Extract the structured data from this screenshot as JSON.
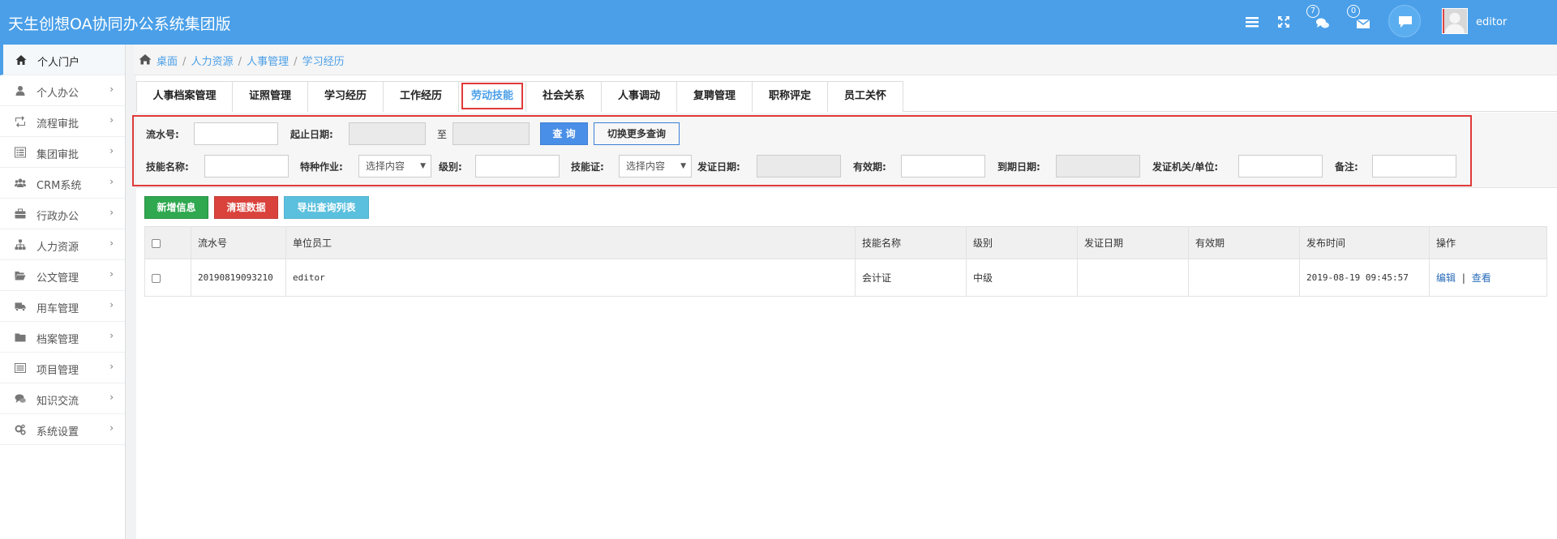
{
  "app": {
    "title": "天生创想OA协同办公系统集团版"
  },
  "header": {
    "icons": [
      "menu-icon",
      "fullscreen-icon",
      "chat-icon",
      "mail-icon",
      "comment-icon"
    ],
    "chat_badge": "7",
    "mail_badge": "0",
    "username": "editor"
  },
  "sidebar": {
    "items": [
      {
        "label": "个人门户",
        "icon": "home-icon"
      },
      {
        "label": "个人办公",
        "icon": "user-icon"
      },
      {
        "label": "流程审批",
        "icon": "retweet-icon"
      },
      {
        "label": "集团审批",
        "icon": "list-alt-icon"
      },
      {
        "label": "CRM系统",
        "icon": "users-icon"
      },
      {
        "label": "行政办公",
        "icon": "briefcase-icon"
      },
      {
        "label": "人力资源",
        "icon": "sitemap-icon"
      },
      {
        "label": "公文管理",
        "icon": "folder-open-icon"
      },
      {
        "label": "用车管理",
        "icon": "truck-icon"
      },
      {
        "label": "档案管理",
        "icon": "folder-icon"
      },
      {
        "label": "项目管理",
        "icon": "list-icon"
      },
      {
        "label": "知识交流",
        "icon": "comments-icon"
      },
      {
        "label": "系统设置",
        "icon": "cogs-icon"
      }
    ]
  },
  "breadcrumb": {
    "items": [
      "桌面",
      "人力资源",
      "人事管理",
      "学习经历"
    ]
  },
  "tabs": [
    {
      "label": "人事档案管理"
    },
    {
      "label": "证照管理"
    },
    {
      "label": "学习经历"
    },
    {
      "label": "工作经历"
    },
    {
      "label": "劳动技能",
      "active": true
    },
    {
      "label": "社会关系"
    },
    {
      "label": "人事调动"
    },
    {
      "label": "复聘管理"
    },
    {
      "label": "职称评定"
    },
    {
      "label": "员工关怀"
    }
  ],
  "search": {
    "serial_label": "流水号:",
    "date_range_label": "起止日期:",
    "to_label": "至",
    "query_button": "查 询",
    "toggle_button": "切换更多查询",
    "skill_name_label": "技能名称:",
    "special_work_label": "特种作业:",
    "special_work_value": "选择内容",
    "level_label": "级别:",
    "skill_cert_label": "技能证:",
    "skill_cert_value": "选择内容",
    "issue_date_label": "发证日期:",
    "valid_label": "有效期:",
    "expire_label": "到期日期:",
    "issuer_label": "发证机关/单位:",
    "remark_label": "备注:"
  },
  "actions": {
    "add": "新增信息",
    "clear": "清理数据",
    "export": "导出查询列表"
  },
  "table": {
    "headers": [
      "",
      "流水号",
      "单位员工",
      "技能名称",
      "级别",
      "发证日期",
      "有效期",
      "发布时间",
      "操作"
    ],
    "rows": [
      {
        "serial": "20190819093210",
        "employee": "editor",
        "skill": "会计证",
        "level": "中级",
        "issue_date": "",
        "valid": "",
        "published": "2019-08-19 09:45:57",
        "edit": "编辑",
        "sep": "|",
        "view": "查看"
      }
    ]
  },
  "colors": {
    "accent": "#4a9fe8",
    "highlight": "#e03a3a"
  }
}
